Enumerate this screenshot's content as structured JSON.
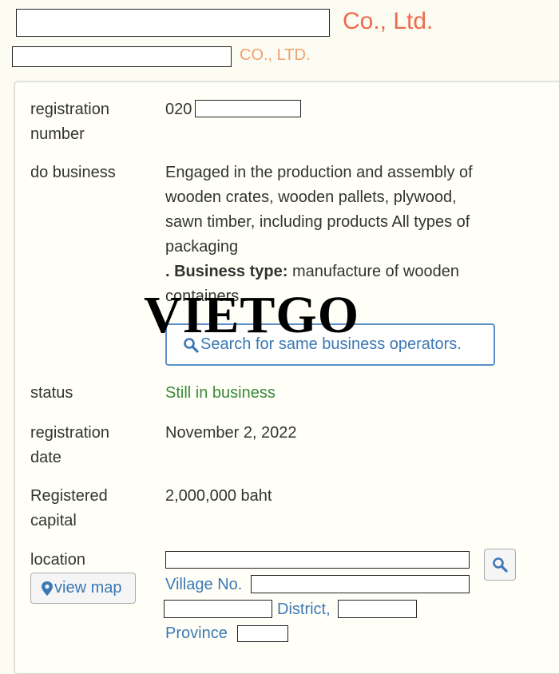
{
  "header": {
    "company_suffix": "Co., Ltd.",
    "company_suffix_caps": "CO., LTD."
  },
  "fields": {
    "registration_number": {
      "label_line1": "registration",
      "label_line2": "number",
      "value_prefix": "020"
    },
    "do_business": {
      "label": "do business",
      "lines": [
        "Engaged in the production and assembly of",
        "wooden crates, wooden pallets, plywood,",
        "sawn timber, including products All types of",
        "packaging"
      ],
      "business_type_label": ". Business type:",
      "business_type_value_line1": " manufacture of wooden",
      "business_type_value_line2": "containers"
    },
    "status": {
      "label": "status",
      "value": "Still in business"
    },
    "registration_date": {
      "label_line1": "registration",
      "label_line2": "date",
      "value": "November 2, 2022"
    },
    "registered_capital": {
      "label_line1": "Registered",
      "label_line2": "capital",
      "value": "2,000,000 baht"
    },
    "location": {
      "label": "location",
      "view_map_label": "view map",
      "village_label": "Village No.",
      "district_label": "District,",
      "province_label": "Province"
    }
  },
  "search_same_business_label": "Search for same business operators.",
  "watermark": "VIETGO",
  "colors": {
    "title_orange": "#ef6a4a",
    "subtitle_orange": "#f0a070",
    "status_green": "#3a8a3a",
    "link_blue": "#3c78b4"
  },
  "icons": {
    "search": "magnifier-icon",
    "map": "map-pin-icon"
  }
}
